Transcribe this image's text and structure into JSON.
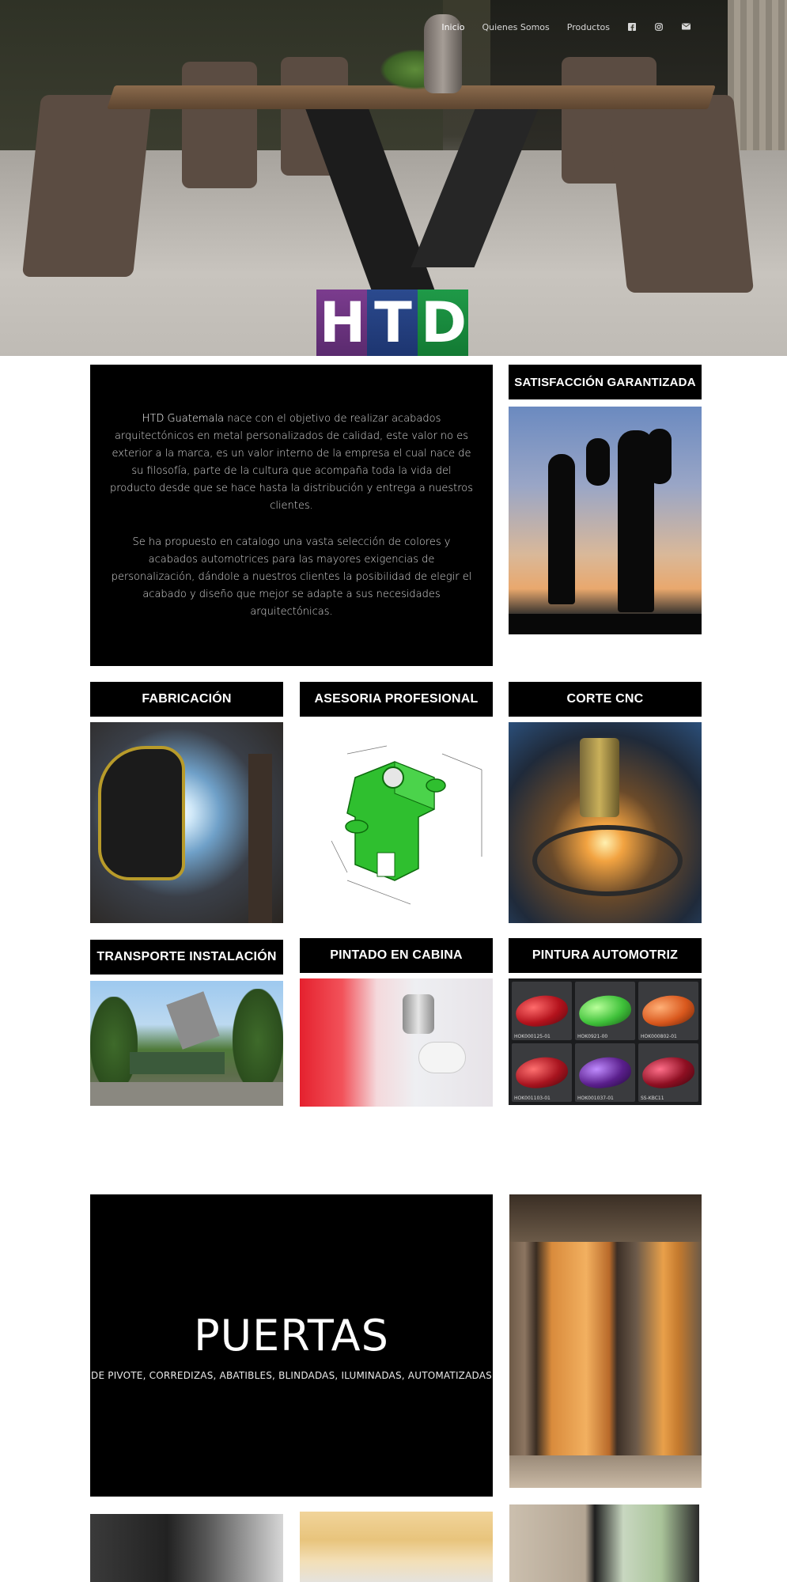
{
  "nav": {
    "items": [
      "Inicio",
      "Quienes Somos",
      "Productos"
    ],
    "social": [
      "facebook-icon",
      "instagram-icon",
      "envelope-icon"
    ]
  },
  "logo": {
    "letters": [
      "H",
      "T",
      "D"
    ]
  },
  "intro": {
    "brand": "HTD Guatemala",
    "p1_rest": " nace con el objetivo de realizar acabados arquitectónicos en metal personalizados de calidad, este valor no es exterior a la marca, es un valor interno de la empresa el cual nace de su filosofía, parte de la cultura que acompaña toda la vida del producto desde que se hace hasta la distribución y entrega a nuestros clientes.",
    "p2": "Se ha propuesto en catalogo una vasta selección de colores y acabados automotrices para las mayores exigencias de personalización, dándole a nuestros clientes la posibilidad de elegir el acabado y diseño que mejor se adapte a sus necesidades arquitectónicas."
  },
  "services": {
    "satisfaccion": "SATISFACCIÓN GARANTIZADA",
    "fabricacion": "FABRICACIÓN",
    "asesoria": "ASESORIA PROFESIONAL",
    "corte": "CORTE CNC",
    "transporte": "TRANSPORTE INSTALACIÓN",
    "pintado": "PINTADO EN CABINA",
    "pintura": "PINTURA AUTOMOTRIZ"
  },
  "swatches": [
    {
      "code": "HOK000125-01",
      "color": "#b3121c"
    },
    {
      "code": "HOK0921-00",
      "color": "#3fc13a"
    },
    {
      "code": "HOK000802-01",
      "color": "#d9581d"
    },
    {
      "code": "HOK001103-01",
      "color": "#a8141f"
    },
    {
      "code": "HOK001037-01",
      "color": "#5a1f8c"
    },
    {
      "code": "SS-KBC11",
      "color": "#8e0f22"
    }
  ],
  "puertas": {
    "title": "PUERTAS",
    "subtitle": "DE PIVOTE, CORREDIZAS, ABATIBLES, BLINDADAS, ILUMINADAS, AUTOMATIZADAS"
  }
}
